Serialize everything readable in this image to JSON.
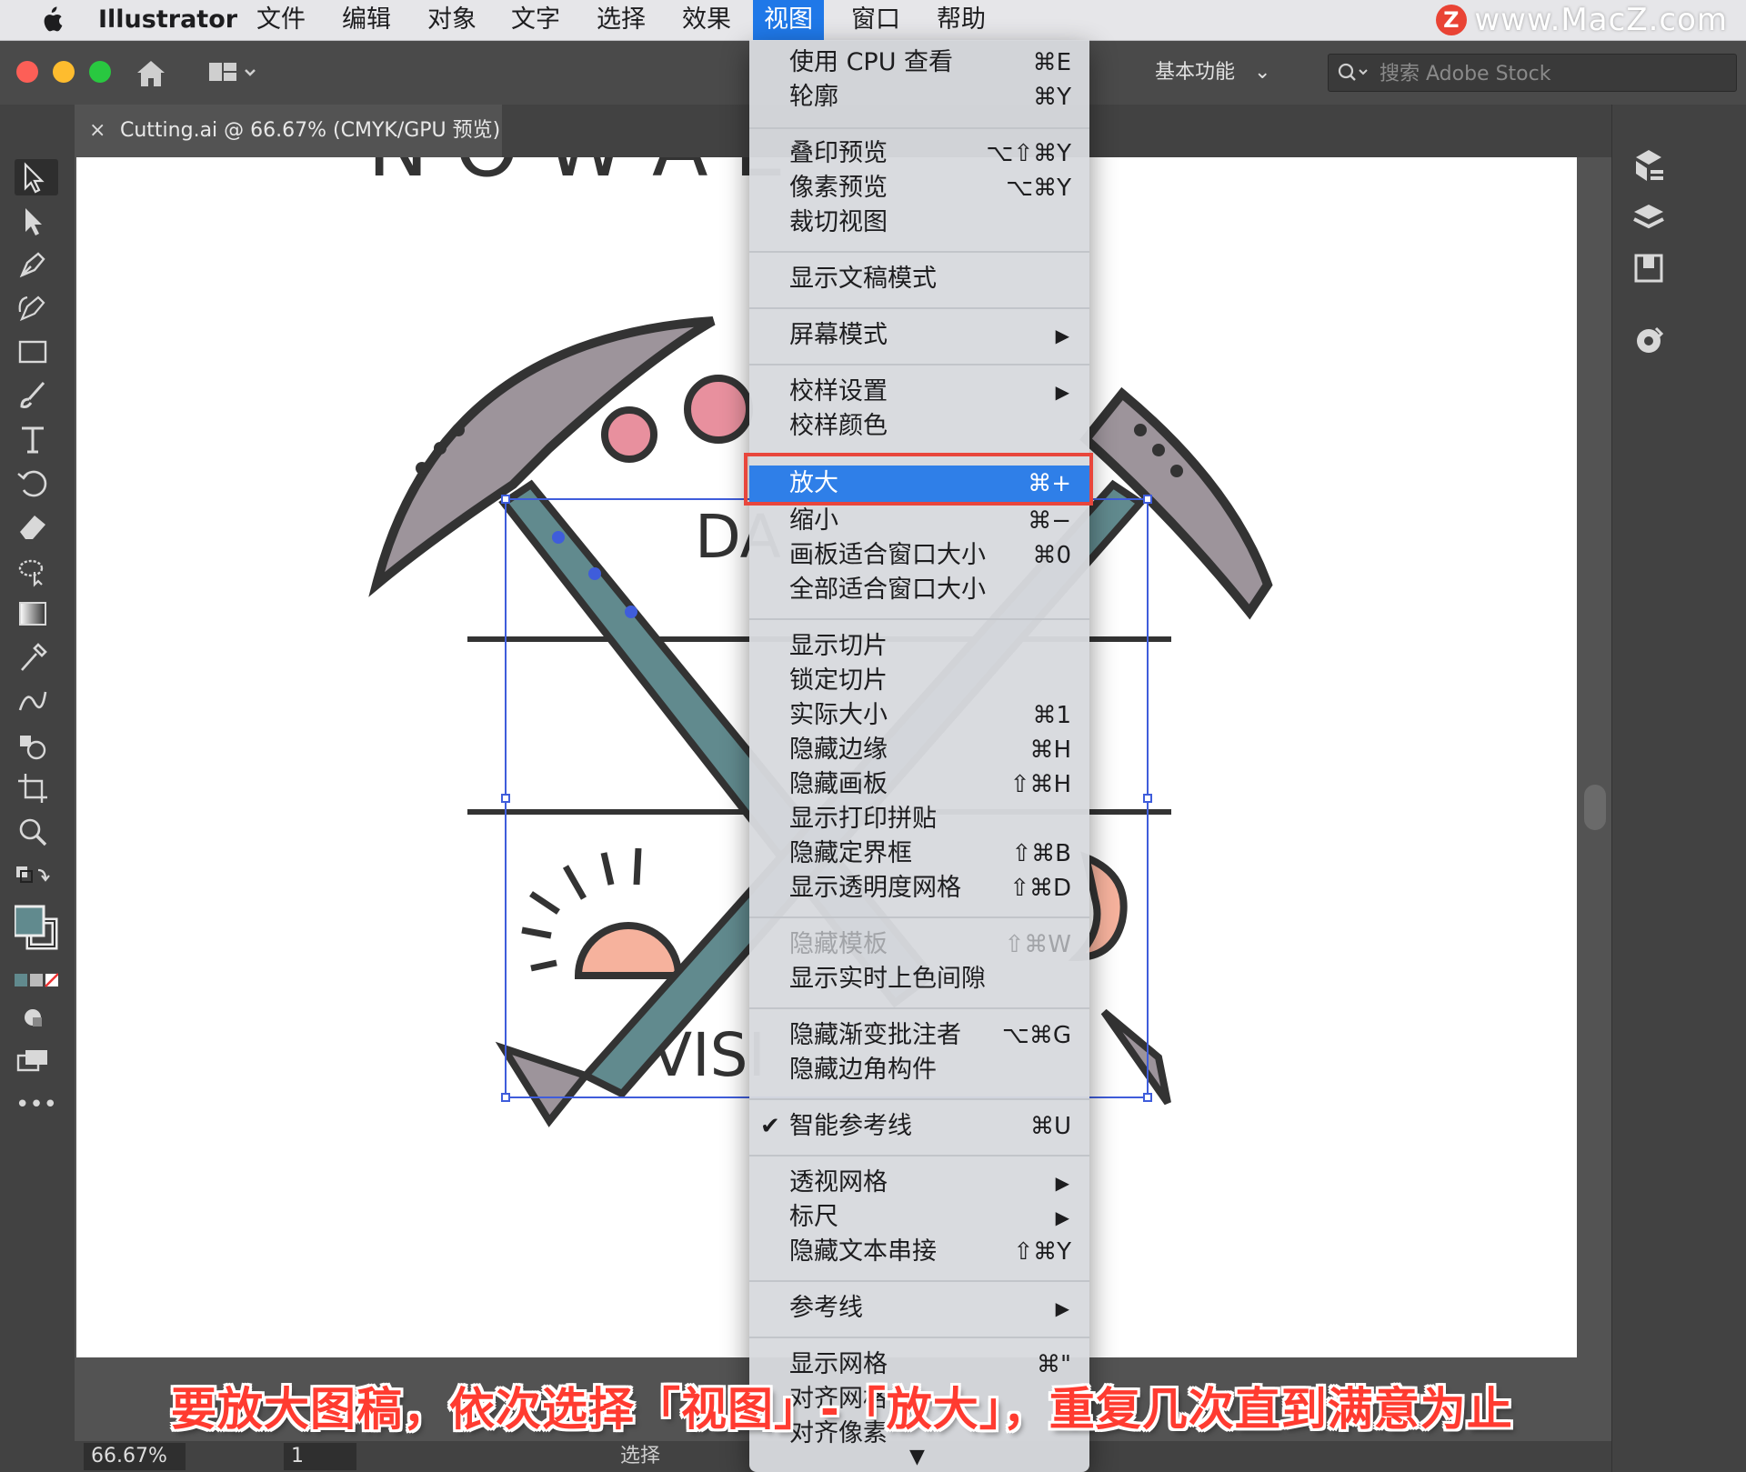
{
  "menubar": {
    "apple": "apple-icon",
    "items": [
      {
        "label": "Illustrator"
      },
      {
        "label": "文件"
      },
      {
        "label": "编辑"
      },
      {
        "label": "对象"
      },
      {
        "label": "文字"
      },
      {
        "label": "选择"
      },
      {
        "label": "效果"
      },
      {
        "label": "视图",
        "active": true
      },
      {
        "label": "窗口"
      },
      {
        "label": "帮助"
      }
    ],
    "watermark": "www.MacZ.com",
    "watermark_icon": "Z"
  },
  "appbar": {
    "workspace": "基本功能",
    "search_placeholder": "搜索 Adobe Stock"
  },
  "document_tab": {
    "close": "×",
    "title": "Cutting.ai @ 66.67% (CMYK/GPU 预览)"
  },
  "statusbar": {
    "zoom": "66.67%",
    "page": "1",
    "label": "选择"
  },
  "view_menu": {
    "items": {
      "cpu": {
        "label": "使用 CPU 查看",
        "shortcut": "⌘E"
      },
      "outline": {
        "label": "轮廓",
        "shortcut": "⌘Y"
      },
      "overprint": {
        "label": "叠印预览",
        "shortcut": "⌥⇧⌘Y"
      },
      "pixel": {
        "label": "像素预览",
        "shortcut": "⌥⌘Y"
      },
      "trim": {
        "label": "裁切视图",
        "shortcut": ""
      },
      "present": {
        "label": "显示文稿模式",
        "shortcut": ""
      },
      "screen": {
        "label": "屏幕模式",
        "shortcut": ""
      },
      "proof_setup": {
        "label": "校样设置",
        "shortcut": ""
      },
      "proof_colors": {
        "label": "校样颜色",
        "shortcut": ""
      },
      "zoom_in": {
        "label": "放大",
        "shortcut": "⌘+"
      },
      "zoom_out": {
        "label": "缩小",
        "shortcut": "⌘−"
      },
      "fit_artboard": {
        "label": "画板适合窗口大小",
        "shortcut": "⌘0"
      },
      "fit_all": {
        "label": "全部适合窗口大小",
        "shortcut": ""
      },
      "show_slices": {
        "label": "显示切片",
        "shortcut": ""
      },
      "lock_slices": {
        "label": "锁定切片",
        "shortcut": ""
      },
      "actual_size": {
        "label": "实际大小",
        "shortcut": "⌘1"
      },
      "hide_edges": {
        "label": "隐藏边缘",
        "shortcut": "⌘H"
      },
      "hide_artboards": {
        "label": "隐藏画板",
        "shortcut": "⇧⌘H"
      },
      "print_tiling": {
        "label": "显示打印拼贴",
        "shortcut": ""
      },
      "hide_bbox": {
        "label": "隐藏定界框",
        "shortcut": "⇧⌘B"
      },
      "transparency_grid": {
        "label": "显示透明度网格",
        "shortcut": "⇧⌘D"
      },
      "hide_template": {
        "label": "隐藏模板",
        "shortcut": "⇧⌘W"
      },
      "live_paint_gaps": {
        "label": "显示实时上色间隙",
        "shortcut": ""
      },
      "gradient_annotator": {
        "label": "隐藏渐变批注者",
        "shortcut": "⌥⌘G"
      },
      "corner_widget": {
        "label": "隐藏边角构件",
        "shortcut": ""
      },
      "smart_guides": {
        "label": "智能参考线",
        "shortcut": "⌘U"
      },
      "perspective_grid": {
        "label": "透视网格",
        "shortcut": ""
      },
      "rulers": {
        "label": "标尺",
        "shortcut": ""
      },
      "text_threads": {
        "label": "隐藏文本串接",
        "shortcut": "⇧⌘Y"
      },
      "guides": {
        "label": "参考线",
        "shortcut": ""
      },
      "show_grid": {
        "label": "显示网格",
        "shortcut": "⌘\""
      },
      "snap_grid": {
        "label": "对齐网格",
        "shortcut": "⇧"
      },
      "snap_pixel": {
        "label": "对齐像素",
        "shortcut": ""
      }
    },
    "check": "✔",
    "submenu_arrow": "▶",
    "more_arrow": "▼"
  },
  "artwork": {
    "text_top": "N O W   A   E",
    "text_mid": "DA",
    "text_bottom": "VISI",
    "colors": {
      "pick_head": "#9d949b",
      "handle": "#618a8e",
      "pink": "#e8909e",
      "sun": "#f6b29d",
      "outline": "#333333",
      "selection": "#3f5ddb"
    }
  },
  "caption": "要放大图稿，依次选择「视图」-「放大」，重复几次直到满意为止"
}
